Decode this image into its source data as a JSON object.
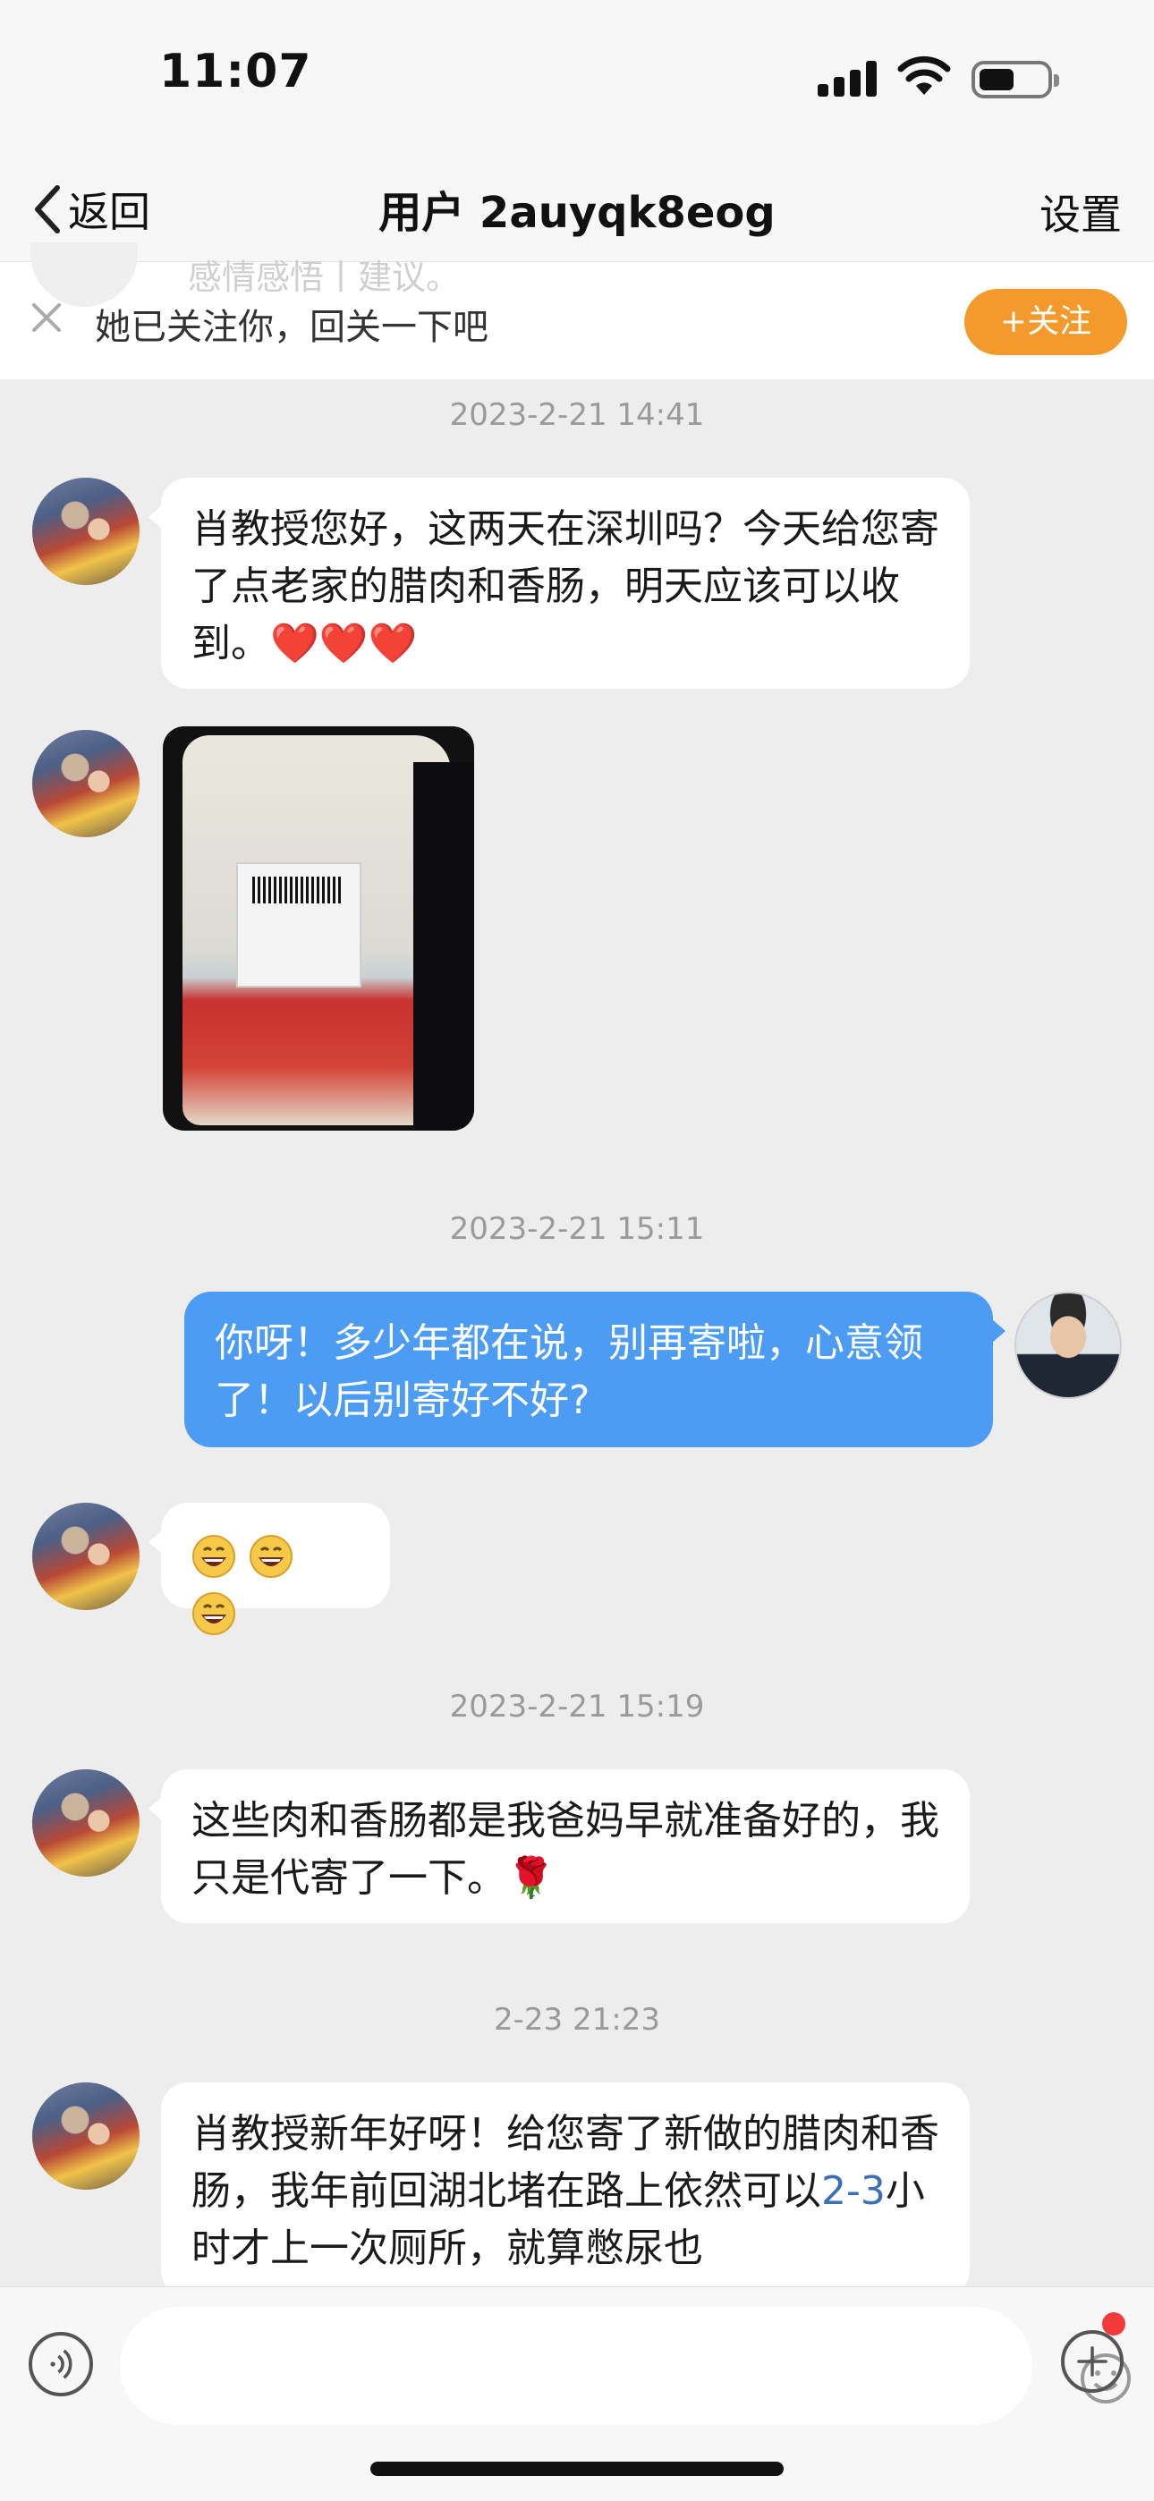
{
  "status_bar": {
    "time": "11:07"
  },
  "nav": {
    "back_label": "返回",
    "title": "用户 2auyqk8eog",
    "settings_label": "设置"
  },
  "follow_bar": {
    "hint_text": "她已关注你，回关一下吧",
    "follow_button": "+关注",
    "ghost_text": "感情感悟丨建议。"
  },
  "chat": {
    "messages": [
      {
        "time": "2023-2-21 14:41",
        "sender": "other",
        "text": "肖教授您好，这两天在深圳吗？今天给您寄了点老家的腊肉和香肠，明天应该可以收到。❤️❤️❤️"
      },
      {
        "sender": "other",
        "type": "image"
      },
      {
        "time": "2023-2-21 15:11",
        "sender": "me",
        "text": "你呀！多少年都在说，别再寄啦，心意领了！以后别寄好不好?"
      },
      {
        "sender": "other",
        "text": "😄😄😄"
      },
      {
        "time": "2023-2-21 15:19",
        "sender": "other",
        "text": "这些肉和香肠都是我爸妈早就准备好的，我只是代寄了一下。🌹"
      },
      {
        "time": "2-23 21:23",
        "sender": "other",
        "text_before": "肖教授新年好呀！给您寄了新做的腊肉和香肠，我年前回湖北堵在路上依然可以",
        "link": "2-3",
        "text_after": "小时才上一次厕所，就算憋尿也"
      }
    ]
  },
  "colors": {
    "accent_orange": "#f49a2d",
    "my_bubble": "#4d9cf3",
    "link": "#3d6fb8",
    "background": "#ededed"
  }
}
